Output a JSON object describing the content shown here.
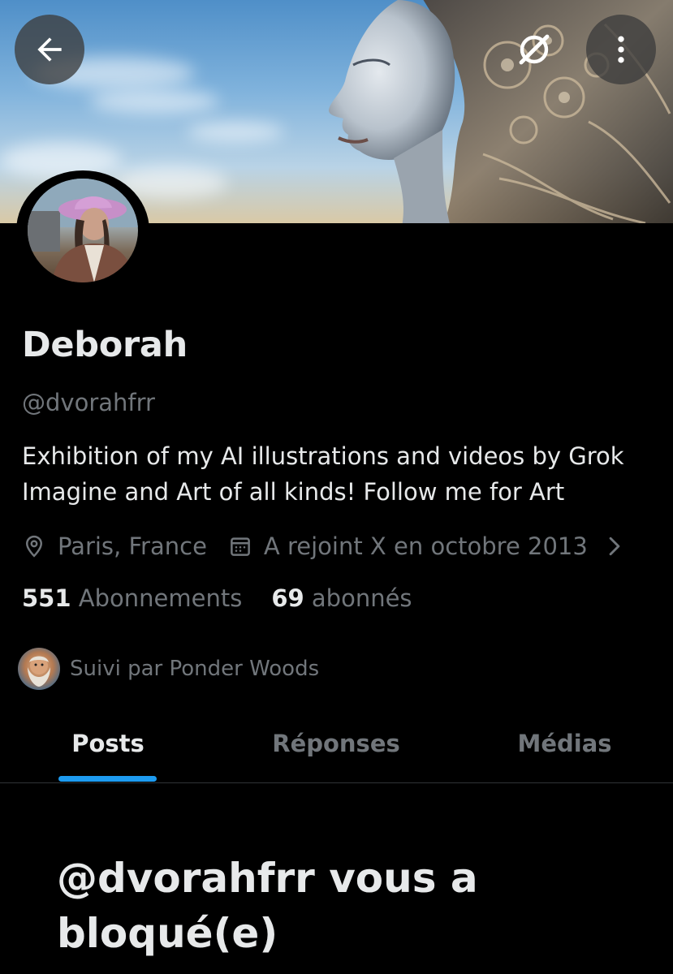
{
  "header": {
    "back_icon": "arrow-left-icon",
    "grok_icon": "grok-icon",
    "more_icon": "more-vertical-icon"
  },
  "profile": {
    "name": "Deborah",
    "handle": "@dvorahfrr",
    "bio": "Exhibition of my AI illustrations and videos by Grok Imagine and Art of all kinds! Follow me for Art",
    "location": "Paris, France",
    "joined": "A rejoint X en octobre 2013",
    "following_count": "551",
    "following_label": "Abonnements",
    "followers_count": "69",
    "followers_label": "abonnés",
    "followed_by": "Suivi par Ponder Woods"
  },
  "tabs": [
    {
      "label": "Posts",
      "active": true
    },
    {
      "label": "Réponses",
      "active": false
    },
    {
      "label": "Médias",
      "active": false
    }
  ],
  "blocked_message": "@dvorahfrr vous a bloqué(e)",
  "colors": {
    "background": "#000000",
    "text_primary": "#e7e9ea",
    "text_secondary": "#71767b",
    "accent": "#1d9bf0",
    "divider": "#2f3336"
  }
}
